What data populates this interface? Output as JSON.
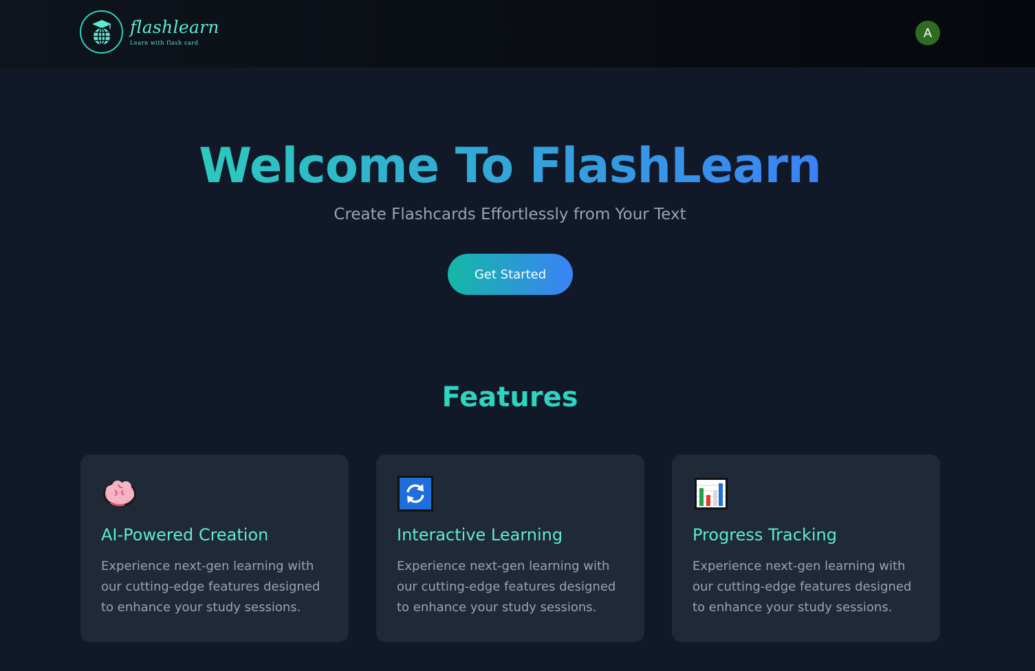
{
  "header": {
    "logo_name": "flashlearn",
    "logo_tagline": "Learn with flash card",
    "avatar_initial": "A"
  },
  "hero": {
    "title": "Welcome To FlashLearn",
    "subtitle": "Create Flashcards Effortlessly from Your Text",
    "cta_label": "Get Started"
  },
  "features": {
    "heading": "Features",
    "cards": [
      {
        "icon": "brain-icon",
        "title": "AI-Powered Creation",
        "description": "Experience next-gen learning with our cutting-edge features designed to enhance your study sessions."
      },
      {
        "icon": "refresh-icon",
        "title": "Interactive Learning",
        "description": "Experience next-gen learning with our cutting-edge features designed to enhance your study sessions."
      },
      {
        "icon": "bar-chart-icon",
        "title": "Progress Tracking",
        "description": "Experience next-gen learning with our cutting-edge features designed to enhance your study sessions."
      }
    ]
  },
  "colors": {
    "background": "#111827",
    "card": "#1f2937",
    "accent_teal": "#2dd4bf",
    "accent_blue": "#3b82f6",
    "avatar": "#2f6b21"
  }
}
